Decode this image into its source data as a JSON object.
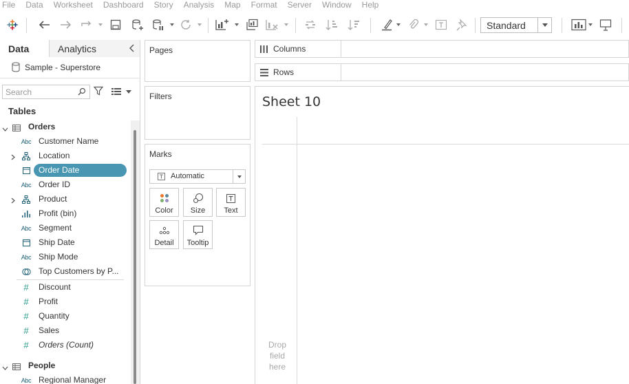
{
  "menu": [
    "File",
    "Data",
    "Worksheet",
    "Dashboard",
    "Story",
    "Analysis",
    "Map",
    "Format",
    "Server",
    "Window",
    "Help"
  ],
  "toolbar": {
    "fit_value": "Standard",
    "icons": [
      "tableau-logo-icon",
      "undo-icon",
      "redo-icon",
      "replay-icon",
      "save-icon",
      "new-datasource-icon",
      "pause-updates-icon",
      "refresh-icon",
      "new-worksheet-icon",
      "duplicate-sheet-icon",
      "clear-sheet-icon",
      "swap-icon",
      "sort-ascending-icon",
      "sort-descending-icon",
      "highlight-icon",
      "group-icon",
      "labels-icon",
      "pin-icon",
      "show-me-icon",
      "presentation-icon"
    ]
  },
  "datapane": {
    "tab_data": "Data",
    "tab_analytics": "Analytics",
    "datasource": "Sample - Superstore",
    "search_placeholder": "Search",
    "tables_heading": "Tables",
    "tables": [
      {
        "name": "Orders",
        "fields": [
          {
            "label": "Customer Name",
            "type": "abc"
          },
          {
            "label": "Location",
            "type": "hierarchy",
            "expandable": true
          },
          {
            "label": "Order Date",
            "type": "date",
            "selected": true
          },
          {
            "label": "Order ID",
            "type": "abc"
          },
          {
            "label": "Product",
            "type": "hierarchy",
            "expandable": true
          },
          {
            "label": "Profit (bin)",
            "type": "bin"
          },
          {
            "label": "Segment",
            "type": "abc"
          },
          {
            "label": "Ship Date",
            "type": "date"
          },
          {
            "label": "Ship Mode",
            "type": "abc"
          },
          {
            "label": "Top Customers by P...",
            "type": "set"
          },
          {
            "label": "Discount",
            "type": "num"
          },
          {
            "label": "Profit",
            "type": "num"
          },
          {
            "label": "Quantity",
            "type": "num"
          },
          {
            "label": "Sales",
            "type": "num"
          },
          {
            "label": "Orders (Count)",
            "type": "num",
            "italic": true
          }
        ]
      },
      {
        "name": "People",
        "fields": [
          {
            "label": "Regional Manager",
            "type": "abc"
          }
        ]
      }
    ]
  },
  "cards": {
    "pages": "Pages",
    "filters": "Filters",
    "marks": "Marks",
    "mark_type": "Automatic",
    "mark_buttons": [
      "Color",
      "Size",
      "Text",
      "Detail",
      "Tooltip"
    ]
  },
  "shelves": {
    "columns": "Columns",
    "rows": "Rows"
  },
  "sheet": {
    "title": "Sheet 10",
    "drop_hint": [
      "Drop",
      "field",
      "here"
    ]
  }
}
